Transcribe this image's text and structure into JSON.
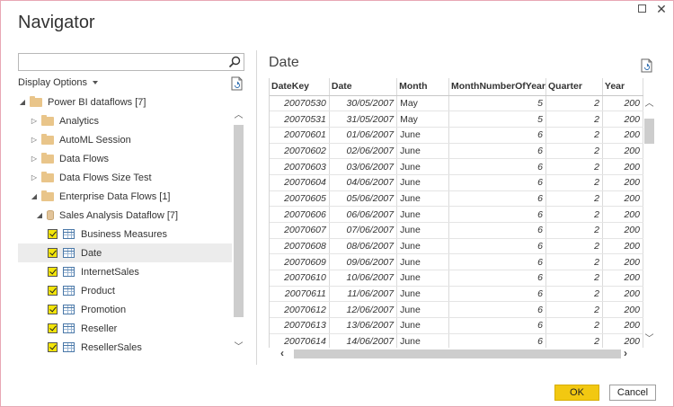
{
  "window": {
    "title": "Navigator"
  },
  "search": {
    "value": "",
    "placeholder": ""
  },
  "display_options": {
    "label": "Display Options"
  },
  "tree": [
    {
      "label": "Power BI dataflows [7]",
      "type": "folder",
      "level": 0,
      "expander": "◢"
    },
    {
      "label": "Analytics",
      "type": "folder",
      "level": 1,
      "expander": "▷"
    },
    {
      "label": "AutoML Session",
      "type": "folder",
      "level": 1,
      "expander": "▷"
    },
    {
      "label": "Data Flows",
      "type": "folder",
      "level": 1,
      "expander": "▷"
    },
    {
      "label": "Data Flows Size Test",
      "type": "folder",
      "level": 1,
      "expander": "▷"
    },
    {
      "label": "Enterprise Data Flows [1]",
      "type": "folder",
      "level": 1,
      "expander": "◢"
    },
    {
      "label": "Sales Analysis Dataflow [7]",
      "type": "database",
      "level": 2,
      "expander": "◢"
    },
    {
      "label": "Business Measures",
      "type": "table",
      "level": 3,
      "checked": true
    },
    {
      "label": "Date",
      "type": "table",
      "level": 3,
      "checked": true,
      "selected": true
    },
    {
      "label": "InternetSales",
      "type": "table",
      "level": 3,
      "checked": true
    },
    {
      "label": "Product",
      "type": "table",
      "level": 3,
      "checked": true
    },
    {
      "label": "Promotion",
      "type": "table",
      "level": 3,
      "checked": true
    },
    {
      "label": "Reseller",
      "type": "table",
      "level": 3,
      "checked": true
    },
    {
      "label": "ResellerSales",
      "type": "table",
      "level": 3,
      "checked": true
    }
  ],
  "preview": {
    "title": "Date",
    "columns": [
      "DateKey",
      "Date",
      "Month",
      "MonthNumberOfYear",
      "Quarter",
      "Year"
    ],
    "rows": [
      [
        "20070530",
        "30/05/2007",
        "May",
        "5",
        "2",
        "200"
      ],
      [
        "20070531",
        "31/05/2007",
        "May",
        "5",
        "2",
        "200"
      ],
      [
        "20070601",
        "01/06/2007",
        "June",
        "6",
        "2",
        "200"
      ],
      [
        "20070602",
        "02/06/2007",
        "June",
        "6",
        "2",
        "200"
      ],
      [
        "20070603",
        "03/06/2007",
        "June",
        "6",
        "2",
        "200"
      ],
      [
        "20070604",
        "04/06/2007",
        "June",
        "6",
        "2",
        "200"
      ],
      [
        "20070605",
        "05/06/2007",
        "June",
        "6",
        "2",
        "200"
      ],
      [
        "20070606",
        "06/06/2007",
        "June",
        "6",
        "2",
        "200"
      ],
      [
        "20070607",
        "07/06/2007",
        "June",
        "6",
        "2",
        "200"
      ],
      [
        "20070608",
        "08/06/2007",
        "June",
        "6",
        "2",
        "200"
      ],
      [
        "20070609",
        "09/06/2007",
        "June",
        "6",
        "2",
        "200"
      ],
      [
        "20070610",
        "10/06/2007",
        "June",
        "6",
        "2",
        "200"
      ],
      [
        "20070611",
        "11/06/2007",
        "June",
        "6",
        "2",
        "200"
      ],
      [
        "20070612",
        "12/06/2007",
        "June",
        "6",
        "2",
        "200"
      ],
      [
        "20070613",
        "13/06/2007",
        "June",
        "6",
        "2",
        "200"
      ],
      [
        "20070614",
        "14/06/2007",
        "June",
        "6",
        "2",
        "200"
      ]
    ]
  },
  "buttons": {
    "ok": "OK",
    "cancel": "Cancel"
  },
  "colors": {
    "accent": "#f2c811",
    "border": "#e8a7b5"
  }
}
